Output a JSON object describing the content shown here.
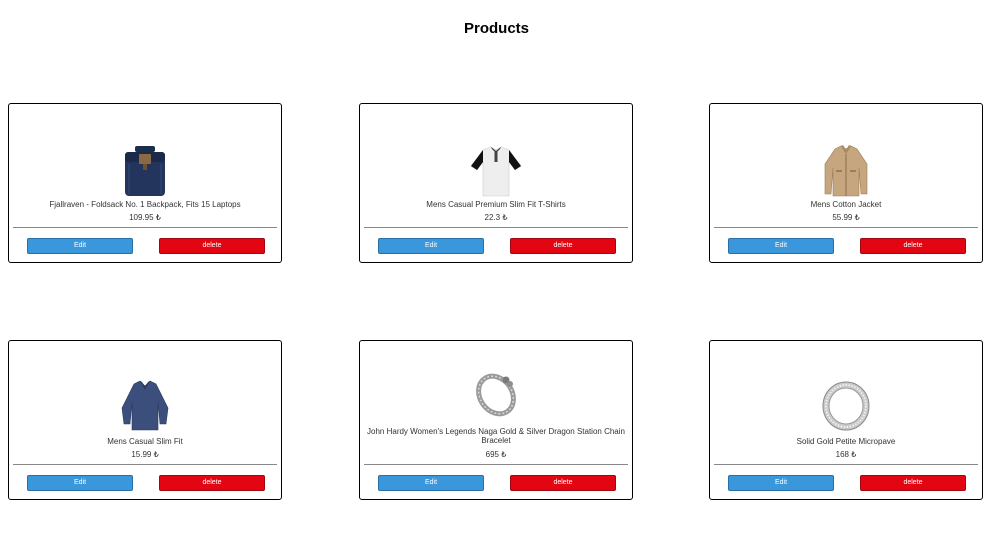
{
  "page": {
    "title": "Products"
  },
  "buttons": {
    "edit_label": "Edit",
    "delete_label": "delete"
  },
  "products": [
    {
      "name": "Fjallraven - Foldsack No. 1 Backpack, Fits 15 Laptops",
      "price": "109.95 ₺",
      "icon": "backpack-image"
    },
    {
      "name": "Mens Casual Premium Slim Fit T-Shirts",
      "price": "22.3 ₺",
      "icon": "tshirt-image"
    },
    {
      "name": "Mens Cotton Jacket",
      "price": "55.99 ₺",
      "icon": "jacket-image"
    },
    {
      "name": "Mens Casual Slim Fit",
      "price": "15.99 ₺",
      "icon": "sweater-image"
    },
    {
      "name": "John Hardy Women's Legends Naga Gold & Silver Dragon Station Chain Bracelet",
      "price": "695 ₺",
      "icon": "bracelet-image"
    },
    {
      "name": "Solid Gold Petite Micropave",
      "price": "168 ₺",
      "icon": "ring-image"
    }
  ],
  "colors": {
    "edit": "#3a97dc",
    "delete": "#e30612"
  }
}
